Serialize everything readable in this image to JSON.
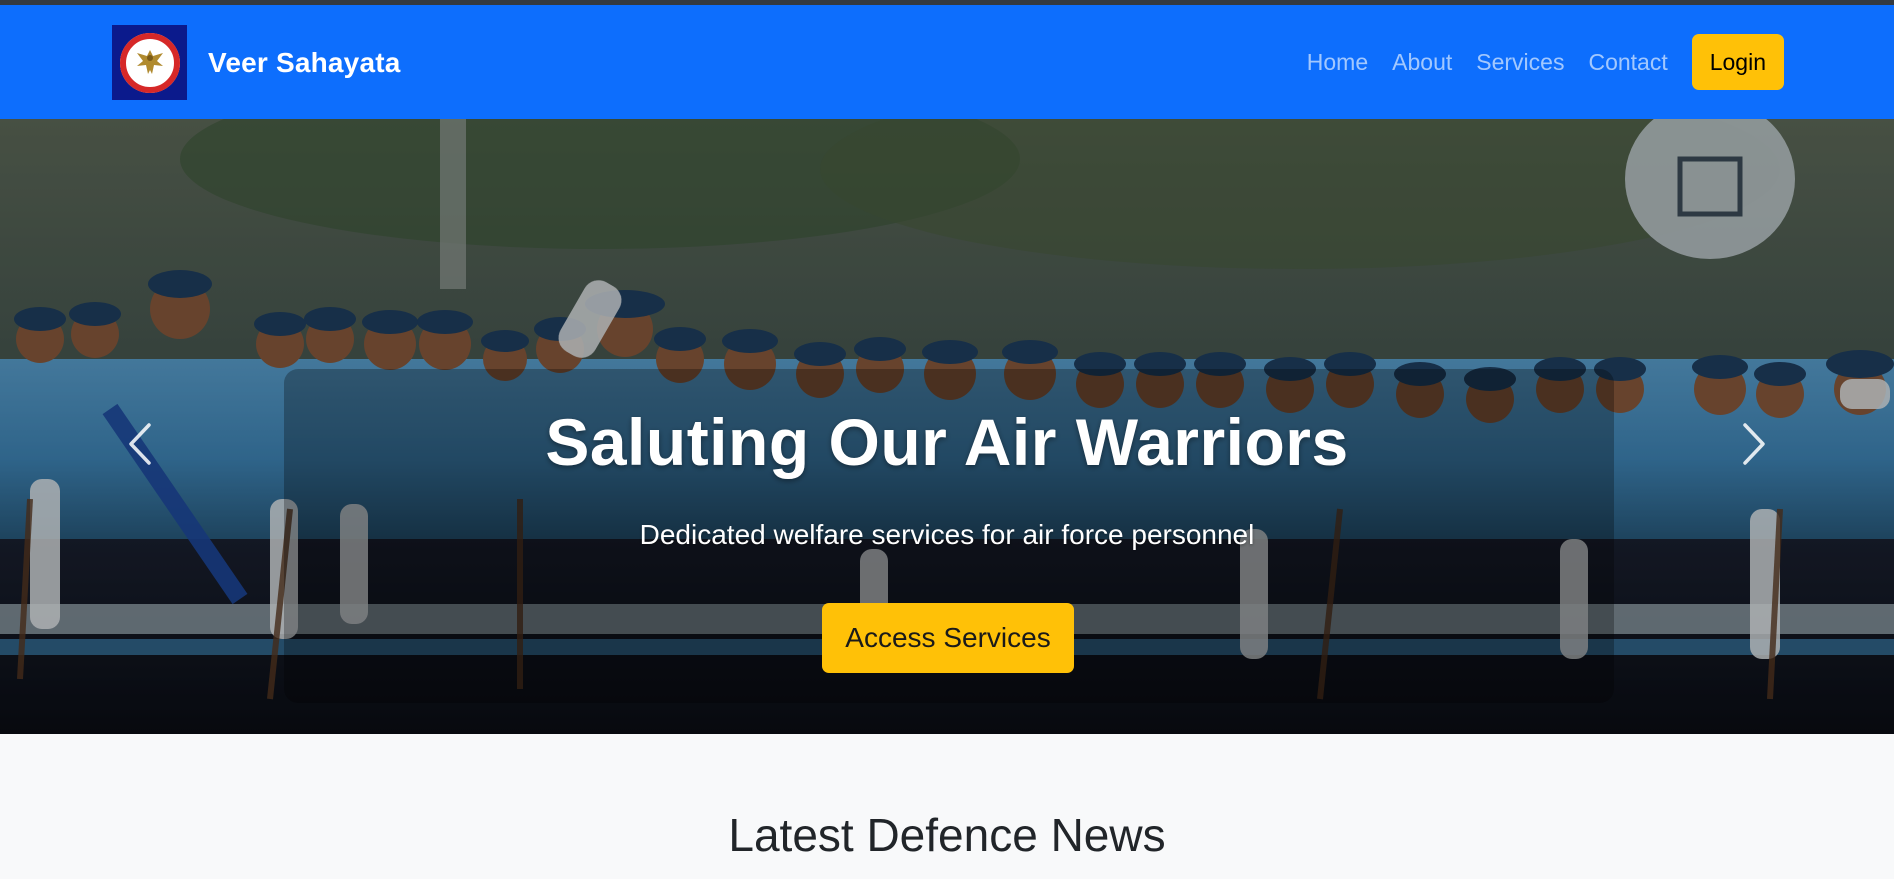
{
  "navbar": {
    "brand_name": "Veer Sahayata",
    "logo_icon": "eagle-emblem-icon",
    "links": [
      {
        "label": "Home"
      },
      {
        "label": "About"
      },
      {
        "label": "Services"
      },
      {
        "label": "Contact"
      }
    ],
    "login_label": "Login",
    "background_color": "#0d6efd"
  },
  "hero": {
    "title": "Saluting Our Air Warriors",
    "subtitle": "Dedicated welfare services for air force personnel",
    "cta_label": "Access Services",
    "prev_icon": "chevron-left-icon",
    "next_icon": "chevron-right-icon"
  },
  "news": {
    "heading": "Latest Defence News"
  },
  "colors": {
    "accent": "#ffc107",
    "brand": "#0d6efd",
    "page_background": "#f8f9fa"
  }
}
